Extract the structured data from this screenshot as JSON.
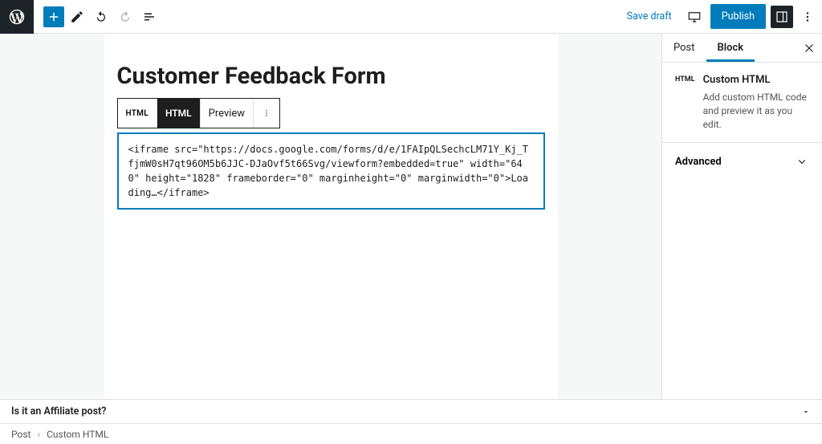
{
  "topbar": {
    "save_draft": "Save draft",
    "publish": "Publish"
  },
  "post": {
    "title": "Customer Feedback Form"
  },
  "block_toolbar": {
    "type_label": "HTML",
    "html_label": "HTML",
    "preview_label": "Preview"
  },
  "html_block": {
    "content": "<iframe src=\"https://docs.google.com/forms/d/e/1FAIpQLSechcLM71Y_Kj_TfjmW0sH7qt96OM5b6JJC-DJaOvf5t66Svg/viewform?embedded=true\" width=\"640\" height=\"1828\" frameborder=\"0\" marginheight=\"0\" marginwidth=\"0\">Loading…</iframe>"
  },
  "sidebar": {
    "tabs": {
      "post": "Post",
      "block": "Block"
    },
    "panel": {
      "icon_label": "HTML",
      "title": "Custom HTML",
      "desc": "Add custom HTML code and preview it as you edit."
    },
    "advanced": "Advanced"
  },
  "affiliate": {
    "label": "Is it an Affiliate post?"
  },
  "breadcrumb": {
    "root": "Post",
    "current": "Custom HTML"
  }
}
